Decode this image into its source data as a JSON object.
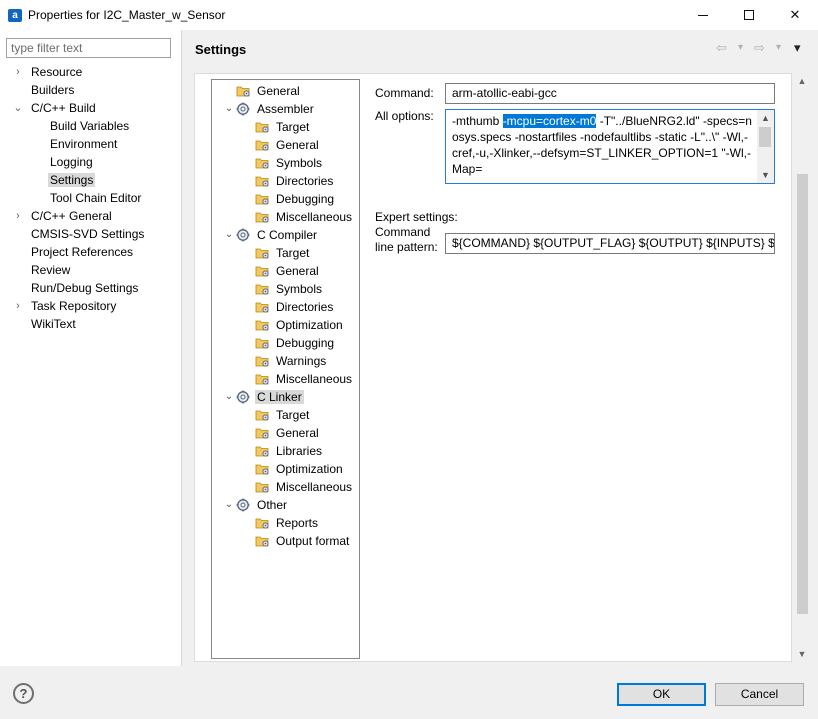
{
  "window": {
    "app_icon": "a",
    "title": "Properties for I2C_Master_w_Sensor",
    "minimize_icon": "minimize-icon",
    "maximize_icon": "maximize-icon",
    "close_label": "✕"
  },
  "filter": {
    "placeholder": "type filter text"
  },
  "nav": {
    "items": [
      {
        "label": "Resource",
        "chevron": "›"
      },
      {
        "label": "Builders"
      },
      {
        "label": "C/C++ Build",
        "chevron": "⌄"
      },
      {
        "label": "Build Variables"
      },
      {
        "label": "Environment"
      },
      {
        "label": "Logging"
      },
      {
        "label": "Settings",
        "selected": true
      },
      {
        "label": "Tool Chain Editor"
      },
      {
        "label": "C/C++ General",
        "chevron": "›"
      },
      {
        "label": "CMSIS-SVD Settings"
      },
      {
        "label": "Project References"
      },
      {
        "label": "Review"
      },
      {
        "label": "Run/Debug Settings"
      },
      {
        "label": "Task Repository",
        "chevron": "›"
      },
      {
        "label": "WikiText"
      }
    ]
  },
  "settings": {
    "title": "Settings",
    "back_icon": "⇦",
    "forward_icon": "⇨",
    "dropdown_icon": "▾",
    "menu_icon": "▾"
  },
  "tree": {
    "items": [
      {
        "label": "General",
        "icon": "folder-icon"
      },
      {
        "label": "Assembler",
        "icon": "gear-icon",
        "chevron": "⌄"
      },
      {
        "label": "Target",
        "icon": "folder-icon"
      },
      {
        "label": "General",
        "icon": "folder-icon"
      },
      {
        "label": "Symbols",
        "icon": "folder-icon"
      },
      {
        "label": "Directories",
        "icon": "folder-icon"
      },
      {
        "label": "Debugging",
        "icon": "folder-icon"
      },
      {
        "label": "Miscellaneous",
        "icon": "folder-icon"
      },
      {
        "label": "C Compiler",
        "icon": "gear-icon",
        "chevron": "⌄"
      },
      {
        "label": "Target",
        "icon": "folder-icon"
      },
      {
        "label": "General",
        "icon": "folder-icon"
      },
      {
        "label": "Symbols",
        "icon": "folder-icon"
      },
      {
        "label": "Directories",
        "icon": "folder-icon"
      },
      {
        "label": "Optimization",
        "icon": "folder-icon"
      },
      {
        "label": "Debugging",
        "icon": "folder-icon"
      },
      {
        "label": "Warnings",
        "icon": "folder-icon"
      },
      {
        "label": "Miscellaneous",
        "icon": "folder-icon"
      },
      {
        "label": "C Linker",
        "icon": "gear-icon",
        "chevron": "⌄",
        "selected": true
      },
      {
        "label": "Target",
        "icon": "folder-icon"
      },
      {
        "label": "General",
        "icon": "folder-icon"
      },
      {
        "label": "Libraries",
        "icon": "folder-icon"
      },
      {
        "label": "Optimization",
        "icon": "folder-icon"
      },
      {
        "label": "Miscellaneous",
        "icon": "folder-icon"
      },
      {
        "label": "Other",
        "icon": "gear-icon",
        "chevron": "⌄"
      },
      {
        "label": "Reports",
        "icon": "folder-icon"
      },
      {
        "label": "Output format",
        "icon": "folder-icon"
      }
    ]
  },
  "form": {
    "command_label": "Command:",
    "command_value": "arm-atollic-eabi-gcc",
    "all_options_label": "All options:",
    "all_options_before": "-mthumb ",
    "all_options_selected": "-mcpu=cortex-m0",
    "all_options_after": " -T\"../BlueNRG2.ld\" -specs=nosys.specs -nostartfiles -nodefaultlibs -static -L\"..\\\" -Wl,-cref,-u,-Xlinker,--defsym=ST_LINKER_OPTION=1 \"-Wl,-Map=",
    "expert_label": "Expert settings:",
    "pattern_label_line1": "Command",
    "pattern_label_line2": "line pattern:",
    "pattern_value": "${COMMAND} ${OUTPUT_FLAG} ${OUTPUT} ${INPUTS} ${FLAGS}"
  },
  "buttons": {
    "help": "?",
    "ok": "OK",
    "cancel": "Cancel"
  }
}
